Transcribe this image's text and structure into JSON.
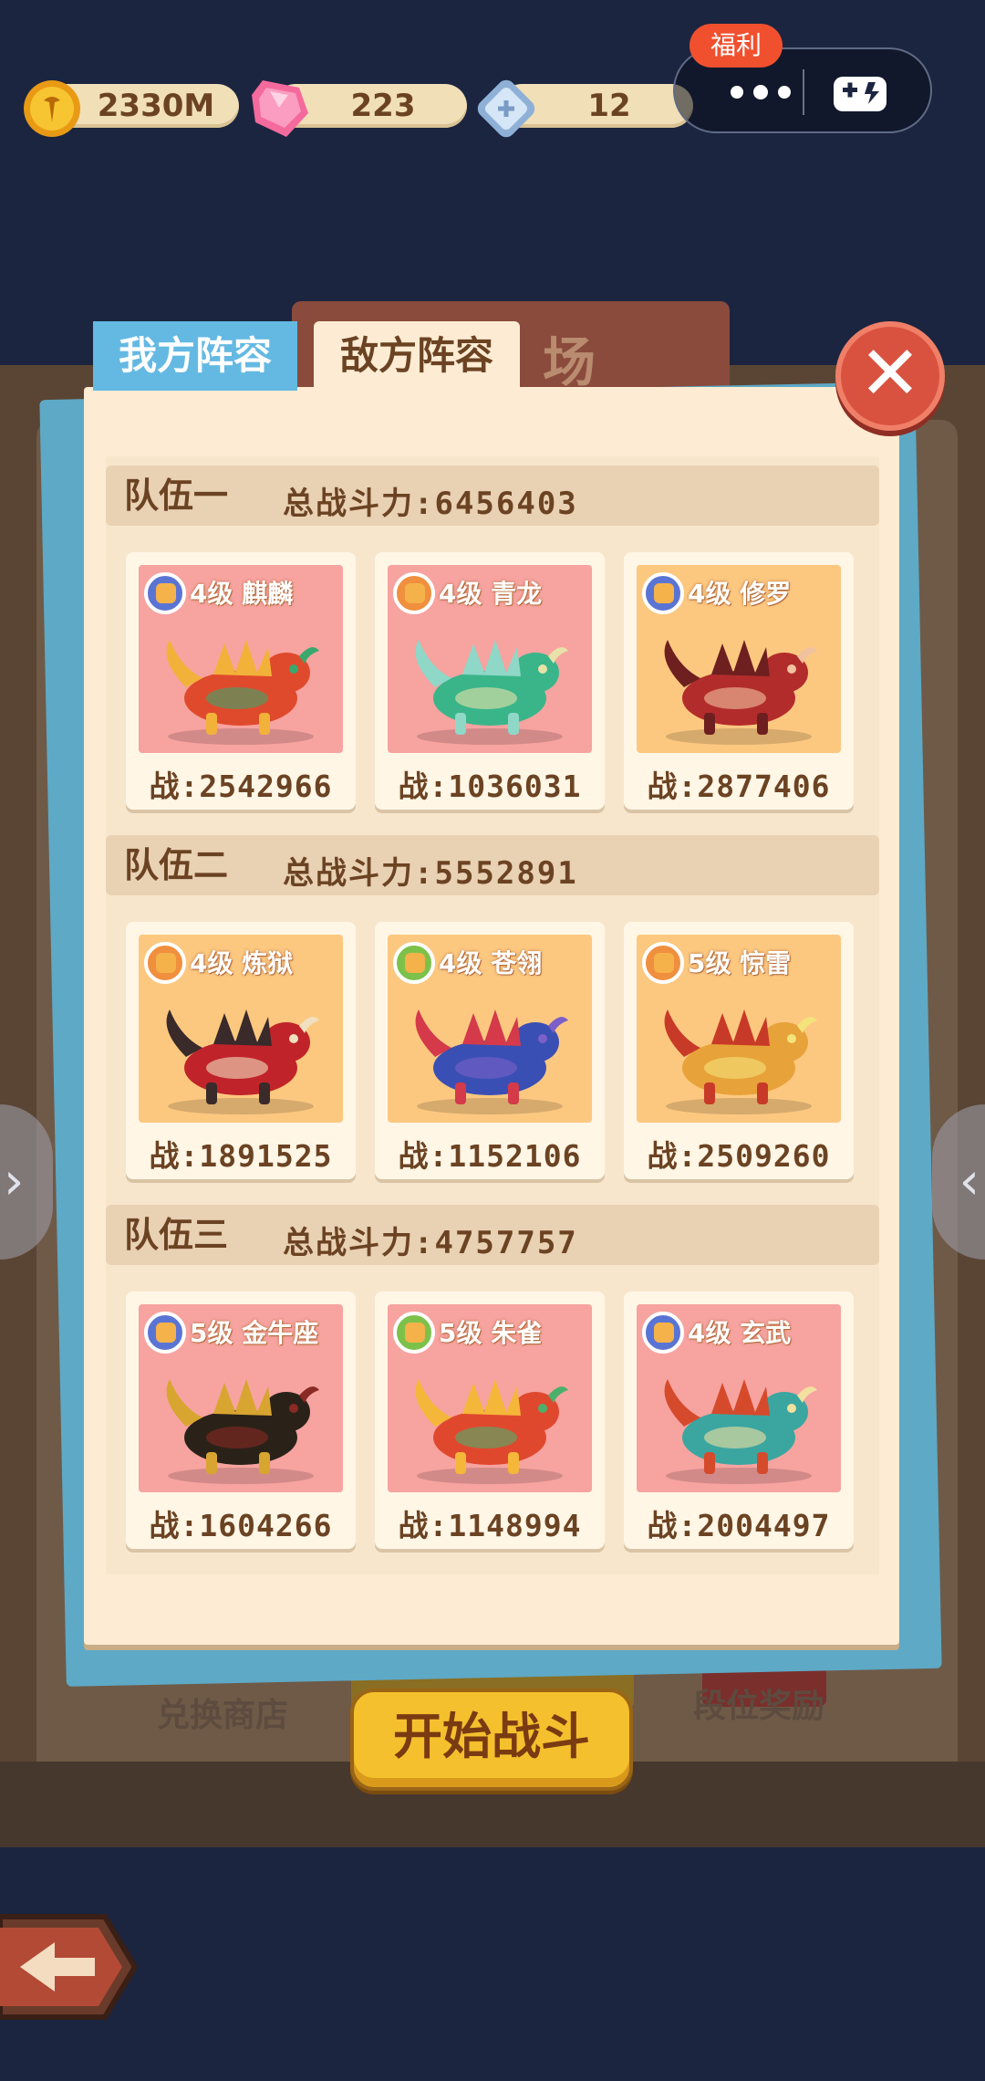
{
  "resources": {
    "coins": "2330M",
    "gems": "223",
    "tickets": "12"
  },
  "capsule": {
    "welfare_badge": "福利",
    "menu_icon": "more-dots-icon",
    "game_icon": "gamepad-icon"
  },
  "background": {
    "shop_label": "兑换商店",
    "rank_reward_label": "段位奖励",
    "title_fragment": "场"
  },
  "tabs": {
    "mine": "我方阵容",
    "enemy": "敌方阵容",
    "active": "enemy"
  },
  "close_label": "✕",
  "start_battle": "开始战斗",
  "teams": [
    {
      "name": "队伍一",
      "total_power": "总战斗力:6456403",
      "cards": [
        {
          "title": "4级 麒麟",
          "power": "战:2542966",
          "bg": "pink",
          "badge": "blue",
          "colors": [
            "#e04a2c",
            "#f2b23a",
            "#3aa76d"
          ]
        },
        {
          "title": "4级 青龙",
          "power": "战:1036031",
          "bg": "pink",
          "badge": "orange",
          "colors": [
            "#3ab58a",
            "#8fd7c7",
            "#e8e2a8"
          ]
        },
        {
          "title": "4级 修罗",
          "power": "战:2877406",
          "bg": "gold",
          "badge": "blue",
          "colors": [
            "#b32c2c",
            "#6e1f1f",
            "#f0c2a0"
          ]
        }
      ]
    },
    {
      "name": "队伍二",
      "total_power": "总战斗力:5552891",
      "cards": [
        {
          "title": "4级 炼狱",
          "power": "战:1891525",
          "bg": "gold",
          "badge": "orange",
          "colors": [
            "#c1232a",
            "#3a2a2a",
            "#f0e0c0"
          ]
        },
        {
          "title": "4级 苍翎",
          "power": "战:1152106",
          "bg": "gold",
          "badge": "green",
          "colors": [
            "#3a4fb4",
            "#d43a4a",
            "#7a60c8"
          ]
        },
        {
          "title": "5级 惊雷",
          "power": "战:2509260",
          "bg": "gold",
          "badge": "orange",
          "colors": [
            "#e8a23a",
            "#c83a28",
            "#f4e27a"
          ]
        }
      ]
    },
    {
      "name": "队伍三",
      "total_power": "总战斗力:4757757",
      "cards": [
        {
          "title": "5级 金牛座",
          "power": "战:1604266",
          "bg": "pink",
          "badge": "blue",
          "colors": [
            "#2a2218",
            "#d8a530",
            "#8a2a24"
          ]
        },
        {
          "title": "5级 朱雀",
          "power": "战:1148994",
          "bg": "pink",
          "badge": "green",
          "colors": [
            "#e0482e",
            "#f5b73a",
            "#4cb06a"
          ]
        },
        {
          "title": "4级 玄武",
          "power": "战:2004497",
          "bg": "pink",
          "badge": "blue",
          "colors": [
            "#3ba6a0",
            "#d64a2c",
            "#f2e0a0"
          ]
        }
      ]
    }
  ]
}
